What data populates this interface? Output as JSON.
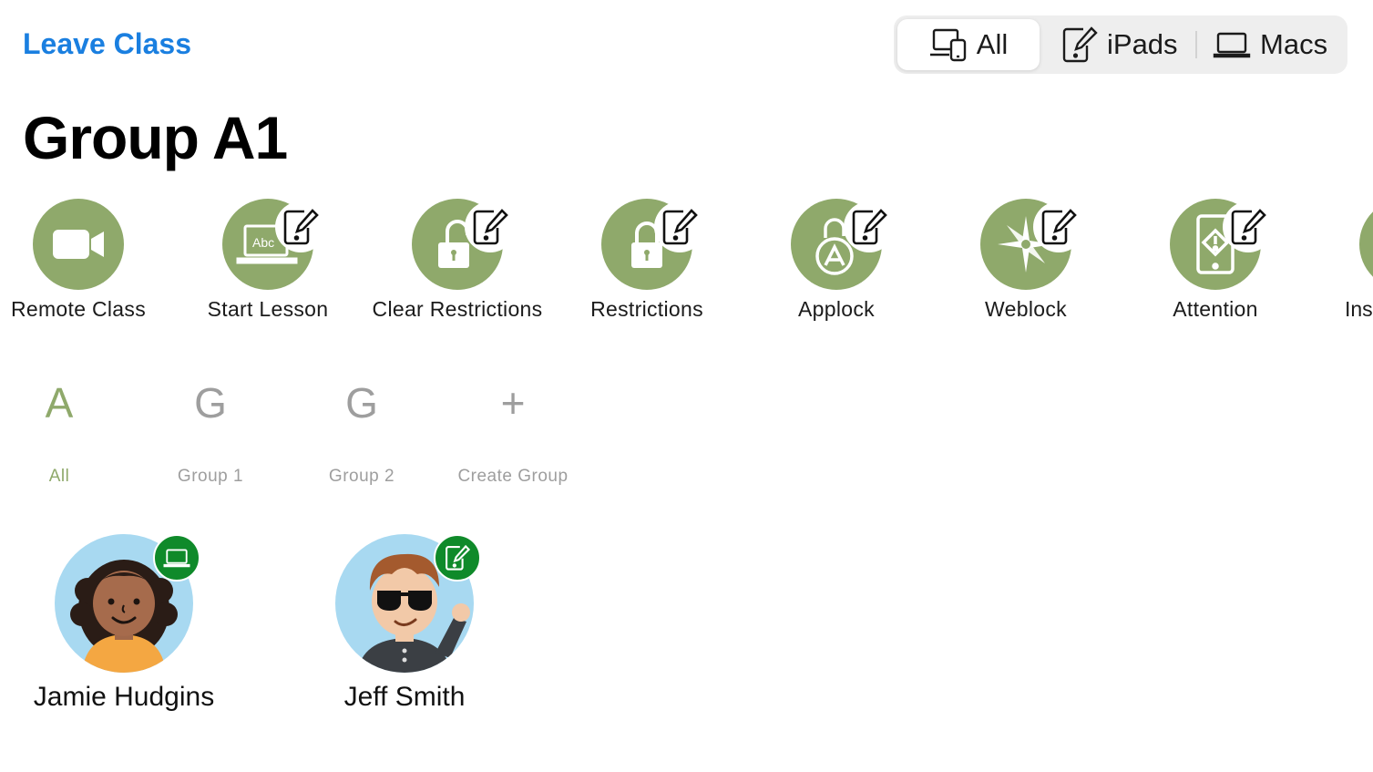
{
  "header": {
    "leave_label": "Leave Class",
    "filter": {
      "all": "All",
      "ipads": "iPads",
      "macs": "Macs",
      "selected": "All"
    }
  },
  "group_title": "Group A1",
  "colors": {
    "accent": "#1a7fe0",
    "action_green": "#8fa96b",
    "status_green": "#0f8a2a",
    "inactive_gray": "#9e9e9e"
  },
  "actions": [
    {
      "label": "Remote Class",
      "icon": "video-camera-icon"
    },
    {
      "label": "Start Lesson",
      "icon": "lesson-laptop-icon",
      "badge": "ipad-edit-icon"
    },
    {
      "label": "Clear Restrictions",
      "icon": "unlock-icon",
      "badge": "ipad-edit-icon"
    },
    {
      "label": "Restrictions",
      "icon": "lock-icon",
      "badge": "ipad-edit-icon"
    },
    {
      "label": "Applock",
      "icon": "app-lock-icon",
      "badge": "ipad-edit-icon"
    },
    {
      "label": "Weblock",
      "icon": "compass-icon",
      "badge": "ipad-edit-icon"
    },
    {
      "label": "Attention",
      "icon": "attention-device-icon",
      "badge": "ipad-edit-icon"
    },
    {
      "label": "Ins",
      "icon": "partial-action-icon"
    }
  ],
  "groups": [
    {
      "letter": "A",
      "label": "All",
      "selected": true
    },
    {
      "letter": "G",
      "label": "Group 1"
    },
    {
      "letter": "G",
      "label": "Group 2"
    },
    {
      "letter": "+",
      "label": "Create Group"
    }
  ],
  "students": [
    {
      "name": "Jamie Hudgins",
      "device": "mac-laptop-icon"
    },
    {
      "name": "Jeff Smith",
      "device": "ipad-edit-icon"
    }
  ]
}
